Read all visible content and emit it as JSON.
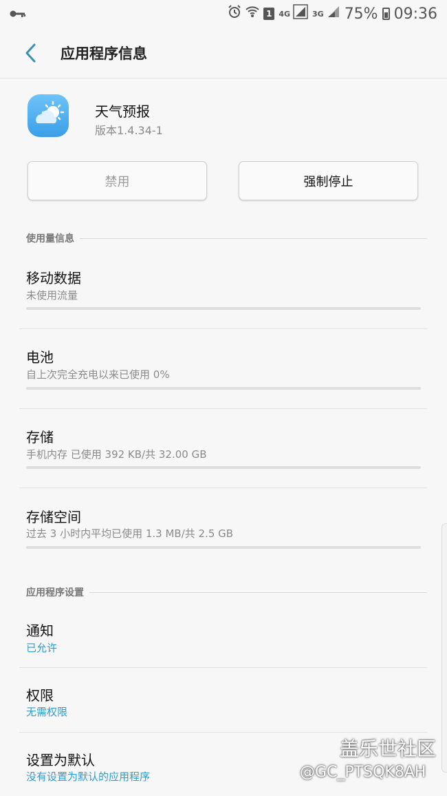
{
  "status_bar": {
    "icons": [
      "key-icon",
      "alarm-icon",
      "wifi-icon",
      "sim1-icon",
      "signal-4g-icon",
      "signal-3g-icon",
      "battery-icon"
    ],
    "sim_label": "1",
    "net1": "4G",
    "net2": "3G",
    "battery": "75%",
    "time": "09:36"
  },
  "header": {
    "title": "应用程序信息"
  },
  "app": {
    "name": "天气预报",
    "version": "版本1.4.34-1",
    "icon": "weather-cloud-sun-icon"
  },
  "buttons": {
    "disable": "禁用",
    "force_stop": "强制停止"
  },
  "usage_section": {
    "title": "使用量信息",
    "items": [
      {
        "title": "移动数据",
        "sub": "未使用流量"
      },
      {
        "title": "电池",
        "sub": "自上次完全充电以来已使用 0%"
      },
      {
        "title": "存储",
        "sub": "手机内存 已使用 392 KB/共 32.00 GB"
      },
      {
        "title": "存储空间",
        "sub": "过去 3 小时内平均已使用 1.3 MB/共 2.5 GB"
      }
    ]
  },
  "settings_section": {
    "title": "应用程序设置",
    "items": [
      {
        "title": "通知",
        "sub": "已允许"
      },
      {
        "title": "权限",
        "sub": "无需权限"
      },
      {
        "title": "设置为默认",
        "sub": "没有设置为默认的应用程序"
      }
    ]
  },
  "watermark": {
    "line1": "盖乐世社区",
    "line2": "@GC_PTSQK8AH"
  },
  "colors": {
    "accent": "#2e9ccf",
    "background": "#f7f7f7"
  }
}
